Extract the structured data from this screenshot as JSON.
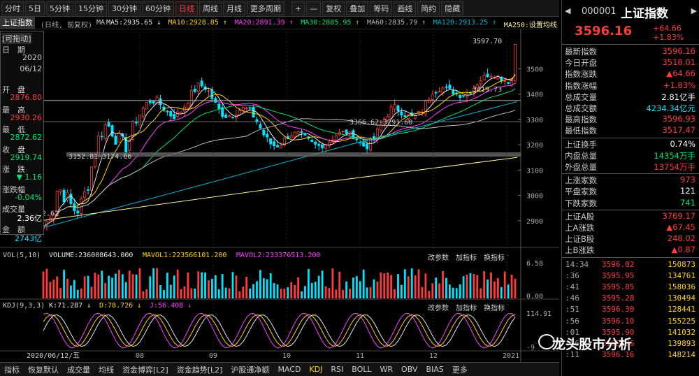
{
  "toolbar": {
    "periods": [
      "分时",
      "5日",
      "5分钟",
      "15分钟",
      "30分钟",
      "60分钟",
      "日线",
      "周线",
      "月线",
      "更多周期"
    ],
    "active_period": "日线",
    "tools": [
      "+",
      "—",
      "复权",
      "叠加",
      "筹码",
      "画线",
      "简约",
      "隐藏"
    ]
  },
  "title_bar": {
    "tab": "上证指数",
    "mode": "(日线, 前复权)",
    "ma_label": "MA",
    "ma": [
      {
        "text": "MA5:2935.65 ↓",
        "color": "#e6e6e6"
      },
      {
        "text": "MA10:2928.85 ↑",
        "color": "#ffd600"
      },
      {
        "text": "MA20:2891.39 ↑",
        "color": "#ff40ff"
      },
      {
        "text": "MA30:2885.95 ↑",
        "color": "#00e676"
      },
      {
        "text": "MA60:2835.79 ↑",
        "color": "#bbbbbb"
      },
      {
        "text": "MA120:2913.25 ↑",
        "color": "#00b8d4"
      },
      {
        "text": "MA250:设置均线",
        "color": "#fff59d"
      }
    ]
  },
  "info_box": {
    "header": "[可拖动]",
    "rows": [
      {
        "label": "日　期",
        "value": "2020"
      },
      {
        "label": "",
        "value": "06/12"
      },
      {
        "label": "开　盘",
        "value": "2876.80",
        "color": "#ff3b3b"
      },
      {
        "label": "最　高",
        "value": "2930.26",
        "color": "#ff3b3b"
      },
      {
        "label": "最　低",
        "value": "2872.62",
        "color": "#00e676"
      },
      {
        "label": "收　盘",
        "value": "2919.74",
        "color": "#00e676"
      },
      {
        "label": "涨　跌",
        "value": "▼ 1.16",
        "color": "#00e676"
      },
      {
        "label": "涨跌幅",
        "value": "-0.04%",
        "color": "#00e676"
      },
      {
        "label": "成交量",
        "value": "2.36亿",
        "color": "#ffffff"
      },
      {
        "label": "金　额",
        "value": "2743亿",
        "color": "#00e5ff"
      }
    ]
  },
  "annotations": {
    "high_label": "3597.70",
    "box_top_label": "3419.73",
    "band1": "3366.62-3291.60",
    "band2": "3152.81-3174.66",
    "low_label": "2.62"
  },
  "chart_data": {
    "type": "candlestick",
    "title": "上证指数",
    "price_axis_ticks": [
      2900,
      3000,
      3100,
      3200,
      3300,
      3400,
      3500
    ],
    "price_ylim": [
      2850,
      3650
    ],
    "x_tick_labels": [
      "08",
      "09",
      "10",
      "11",
      "12",
      "2021"
    ],
    "cursor_date": "2020/06/12/五",
    "summary_candles": [
      {
        "t": "2020/06",
        "o": 2876.8,
        "h": 2930.26,
        "l": 2872.62,
        "c": 2919.74
      },
      {
        "t": "2020/07",
        "o": 2930,
        "h": 3458,
        "l": 2920,
        "c": 3310
      },
      {
        "t": "2020/08",
        "o": 3310,
        "h": 3454,
        "l": 3204,
        "c": 3395
      },
      {
        "t": "2020/09",
        "o": 3395,
        "h": 3425,
        "l": 3202,
        "c": 3218
      },
      {
        "t": "2020/10",
        "o": 3218,
        "h": 3358,
        "l": 3210,
        "c": 3225
      },
      {
        "t": "2020/11",
        "o": 3225,
        "h": 3456,
        "l": 3209,
        "c": 3391
      },
      {
        "t": "2020/12",
        "o": 3391,
        "h": 3474,
        "l": 3325,
        "c": 3473
      },
      {
        "t": "2021/01",
        "o": 3474,
        "h": 3597.7,
        "l": 3474,
        "c": 3596.16
      }
    ],
    "volume_panel": {
      "label": "VOL(5,10)",
      "values": [
        {
          "text": "VOLUME:236008643.000",
          "color": "#e6e6e6"
        },
        {
          "text": "MAVOL1:223566101.200",
          "color": "#ffd600"
        },
        {
          "text": "MAVOL2:233376513.200",
          "color": "#ff40ff"
        }
      ],
      "axis_ticks": [
        "6.58",
        "0.00"
      ],
      "buttons": [
        "改参数",
        "加指标",
        "换指标"
      ]
    },
    "kdj_panel": {
      "label": "KDJ(9,3,3)",
      "values": [
        {
          "text": "K:71.287 ↓",
          "color": "#e6e6e6"
        },
        {
          "text": "D:78.726 ↓",
          "color": "#ffd600"
        },
        {
          "text": "J:56.408 ↓",
          "color": "#ff40ff"
        }
      ],
      "axis_ticks": [
        "114.91",
        "-9"
      ],
      "buttons": [
        "改参数",
        "加指标",
        "换指标"
      ]
    }
  },
  "quote_panel": {
    "code": "000001",
    "name": "上证指数",
    "price": "3596.16",
    "change": "+64.66",
    "change_pct": "+1.83%",
    "stats": [
      {
        "label": "最新指数",
        "value": "3596.16",
        "color": "#ff3b3b"
      },
      {
        "label": "今日开盘",
        "value": "3518.01",
        "color": "#ff3b3b"
      },
      {
        "label": "指数涨跌",
        "value": "▲64.66",
        "color": "#ff3b3b"
      },
      {
        "label": "指数涨幅",
        "value": "+1.83%",
        "color": "#ff3b3b"
      },
      {
        "label": "总成交量",
        "value": "2.81亿手",
        "color": "#ffffff"
      },
      {
        "label": "总成交额",
        "value": "4234.34亿元",
        "color": "#00e5ff"
      },
      {
        "label": "最高指数",
        "value": "3596.93",
        "color": "#ff3b3b"
      },
      {
        "label": "最低指数",
        "value": "3517.47",
        "color": "#ff3b3b"
      }
    ],
    "stats2": [
      {
        "label": "上证换手",
        "value": "0.74%",
        "color": "#ffffff"
      },
      {
        "label": "内盘总量",
        "value": "14354万手",
        "color": "#00e676"
      },
      {
        "label": "外盘总量",
        "value": "13754万手",
        "color": "#ff3b3b"
      }
    ],
    "stats3": [
      {
        "label": "上涨家数",
        "value": "973",
        "color": "#ff3b3b"
      },
      {
        "label": "平盘家数",
        "value": "121",
        "color": "#ffffff"
      },
      {
        "label": "下跌家数",
        "value": "741",
        "color": "#00e676"
      }
    ],
    "stats4": [
      {
        "label": "上证A股",
        "value": "3769.17",
        "color": "#ff3b3b"
      },
      {
        "label": "上A涨跌",
        "value": "▲67.45",
        "color": "#ff3b3b"
      },
      {
        "label": "上证B股",
        "value": "248.02",
        "color": "#ff3b3b"
      },
      {
        "label": "上B涨跌",
        "value": "▲0.87",
        "color": "#ff3b3b"
      }
    ],
    "ticks": [
      {
        "time": "14:34",
        "price": "3596.02",
        "vol": "150873"
      },
      {
        "time": ":36",
        "price": "3595.95",
        "vol": "134761"
      },
      {
        "time": ":41",
        "price": "3595.85",
        "vol": "158036"
      },
      {
        "time": ":46",
        "price": "3595.28",
        "vol": "130494"
      },
      {
        "time": ":51",
        "price": "3596.30",
        "vol": "128441"
      },
      {
        "time": ":56",
        "price": "3596.10",
        "vol": "155225"
      },
      {
        "time": ":01",
        "price": "3595.90",
        "vol": "141032"
      },
      {
        "time": ":06",
        "price": "3595.76",
        "vol": "139893"
      },
      {
        "time": ":11",
        "price": "3596.16",
        "vol": "148214"
      }
    ]
  },
  "bottom_tabs": [
    "指标",
    "恢复默认",
    "成交量",
    "均线",
    "资金博弈[L2]",
    "资金趋势[L2]",
    "沪股通净额",
    "MACD",
    "KDJ",
    "RSI",
    "BOLL",
    "WR",
    "OBV",
    "BIAS",
    "更多"
  ],
  "active_bottom_tab": "KDJ",
  "watermark": "龙头股市分析"
}
